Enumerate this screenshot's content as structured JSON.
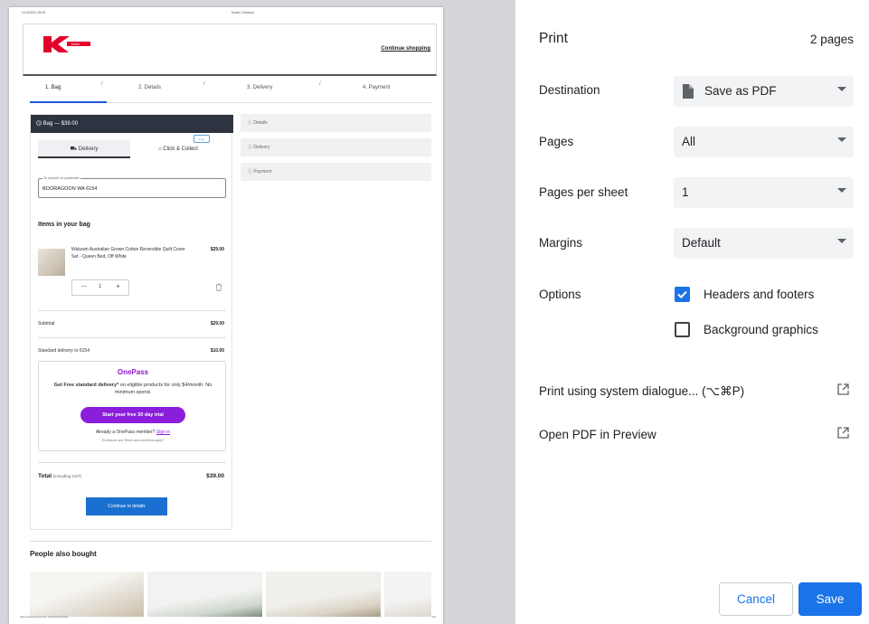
{
  "preview": {
    "header_date": "1/14/2023, 08:39",
    "header_title": "Kmart Checkout",
    "continue_shopping": "Continue shopping",
    "steps": [
      "1. Bag",
      "2. Details",
      "3. Delivery",
      "4. Payment"
    ],
    "bag_header": "Bag — $39.00",
    "tab_delivery": "Delivery",
    "tab_click_collect": "Click & Collect",
    "tooltip": "Free",
    "suburb_label": "To suburb or postcode",
    "suburb_value": "BOORAGOON WA 6154",
    "items_title": "Items in your bag",
    "item_name": "Waluwin Australian Grown Cotton Reversible Quilt Cover Set - Queen Bed, Off White",
    "item_price": "$29.00",
    "item_qty": "1",
    "subtotal_label": "Subtotal",
    "subtotal_value": "$29.00",
    "delivery_label": "Standard delivery to 6154",
    "delivery_value": "$10.00",
    "onepass_logo": "OnePass",
    "onepass_text_bold": "Get Free standard delivery*",
    "onepass_text": " on eligible products for only $4/month. No minimum spend.",
    "onepass_button": "Start your free 30 day trial",
    "onepass_member": "Already a OnePass member?",
    "onepass_signin": "Sign in",
    "onepass_fine": "Exclusions and Terms and conditions apply*",
    "total_label": "Total",
    "total_note": "(including GST)",
    "total_value": "$39.00",
    "continue_button": "Continue to details",
    "right_steps": [
      "Details",
      "Delivery",
      "Payment"
    ],
    "people_title": "People also bought",
    "footer_url": "https://www.kmart.com.au/checkout/bag",
    "footer_page": "1/2"
  },
  "settings": {
    "title": "Print",
    "page_count": "2 pages",
    "destination_label": "Destination",
    "destination_value": "Save as PDF",
    "pages_label": "Pages",
    "pages_value": "All",
    "pps_label": "Pages per sheet",
    "pps_value": "1",
    "margins_label": "Margins",
    "margins_value": "Default",
    "options_label": "Options",
    "opt_headers": "Headers and footers",
    "opt_headers_checked": true,
    "opt_background": "Background graphics",
    "opt_background_checked": false,
    "system_dialog": "Print using system dialogue... (⌥⌘P)",
    "open_preview": "Open PDF in Preview",
    "cancel": "Cancel",
    "save": "Save"
  },
  "colors": {
    "accent": "#1a73e8",
    "onepass": "#8a1edb",
    "kmart_red": "#e4002b"
  }
}
